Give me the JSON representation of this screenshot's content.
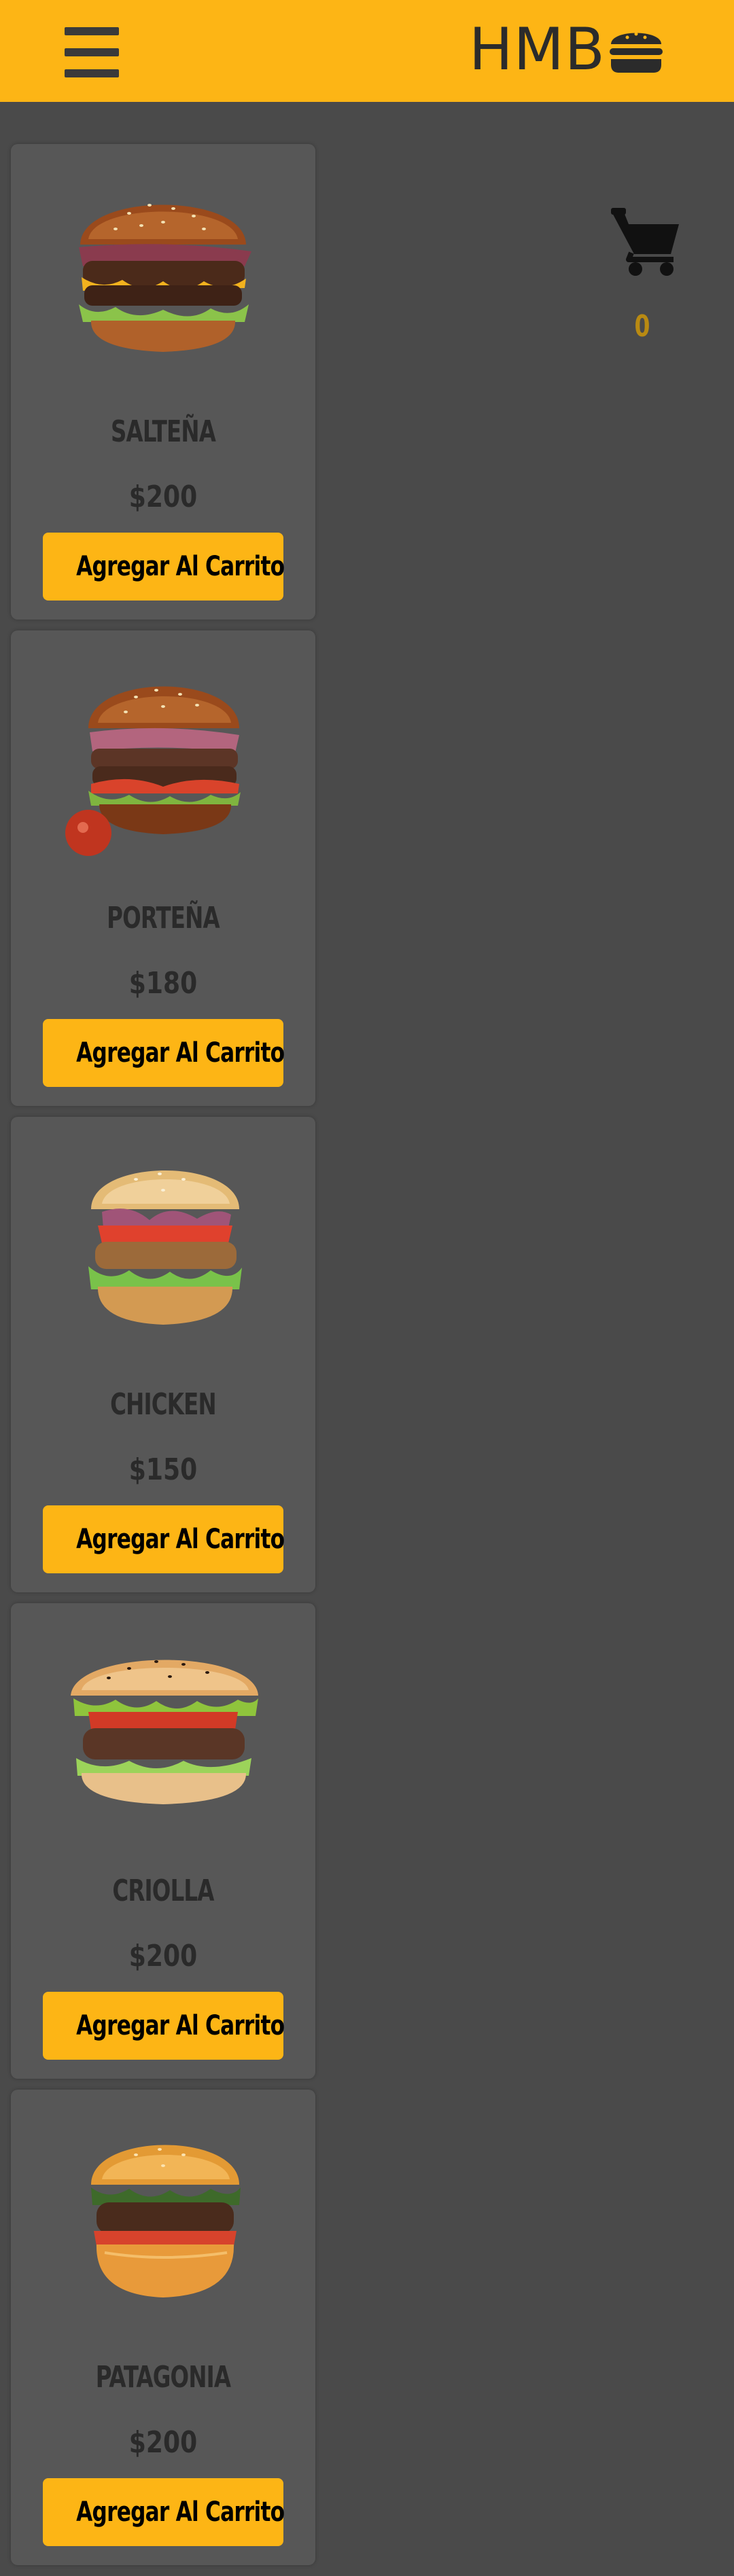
{
  "header": {
    "brand": "HMB",
    "brand_icon": "burger-icon",
    "menu_icon": "hamburger-menu-icon",
    "background": "#fdb515"
  },
  "cart": {
    "icon": "shopping-cart-icon",
    "count": "0"
  },
  "products": [
    {
      "name": "SALTEÑA",
      "price": "$200",
      "button": "Agregar Al Carrito"
    },
    {
      "name": "PORTEÑA",
      "price": "$180",
      "button": "Agregar Al Carrito"
    },
    {
      "name": "CHICKEN",
      "price": "$150",
      "button": "Agregar Al Carrito"
    },
    {
      "name": "CRIOLLA",
      "price": "$200",
      "button": "Agregar Al Carrito"
    },
    {
      "name": "PATAGONIA",
      "price": "$200",
      "button": "Agregar Al Carrito"
    }
  ],
  "colors": {
    "accent": "#fdb515",
    "page_background": "#4a4a4a",
    "card_background": "#575757"
  }
}
